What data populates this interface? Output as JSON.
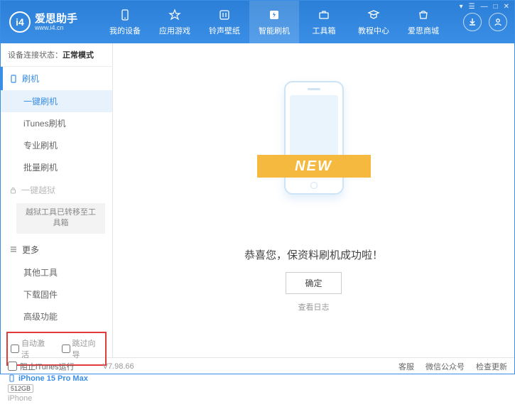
{
  "app": {
    "name": "爱思助手",
    "url": "www.i4.cn"
  },
  "win": {
    "cart": "▾",
    "menu": "☰",
    "min": "—",
    "max": "□",
    "close": "✕"
  },
  "nav": [
    {
      "label": "我的设备"
    },
    {
      "label": "应用游戏"
    },
    {
      "label": "铃声壁纸"
    },
    {
      "label": "智能刷机",
      "active": true
    },
    {
      "label": "工具箱"
    },
    {
      "label": "教程中心"
    },
    {
      "label": "爱思商城"
    }
  ],
  "status": {
    "prefix": "设备连接状态：",
    "value": "正常模式"
  },
  "sidebar": {
    "flash_header": "刷机",
    "flash_items": [
      "一键刷机",
      "iTunes刷机",
      "专业刷机",
      "批量刷机"
    ],
    "flash_active_index": 0,
    "jailbreak_header": "一键越狱",
    "jailbreak_note": "越狱工具已转移至工具箱",
    "more_header": "更多",
    "more_items": [
      "其他工具",
      "下载固件",
      "高级功能"
    ],
    "checks": {
      "auto_activate": "自动激活",
      "skip_guide": "跳过向导"
    }
  },
  "device": {
    "name": "iPhone 15 Pro Max",
    "storage": "512GB",
    "type": "iPhone"
  },
  "main": {
    "ribbon": "NEW",
    "success": "恭喜您，保资料刷机成功啦！",
    "ok": "确定",
    "log_link": "查看日志"
  },
  "footer": {
    "block_itunes": "阻止iTunes运行",
    "version": "V7.98.66",
    "items": [
      "客服",
      "微信公众号",
      "检查更新"
    ]
  }
}
